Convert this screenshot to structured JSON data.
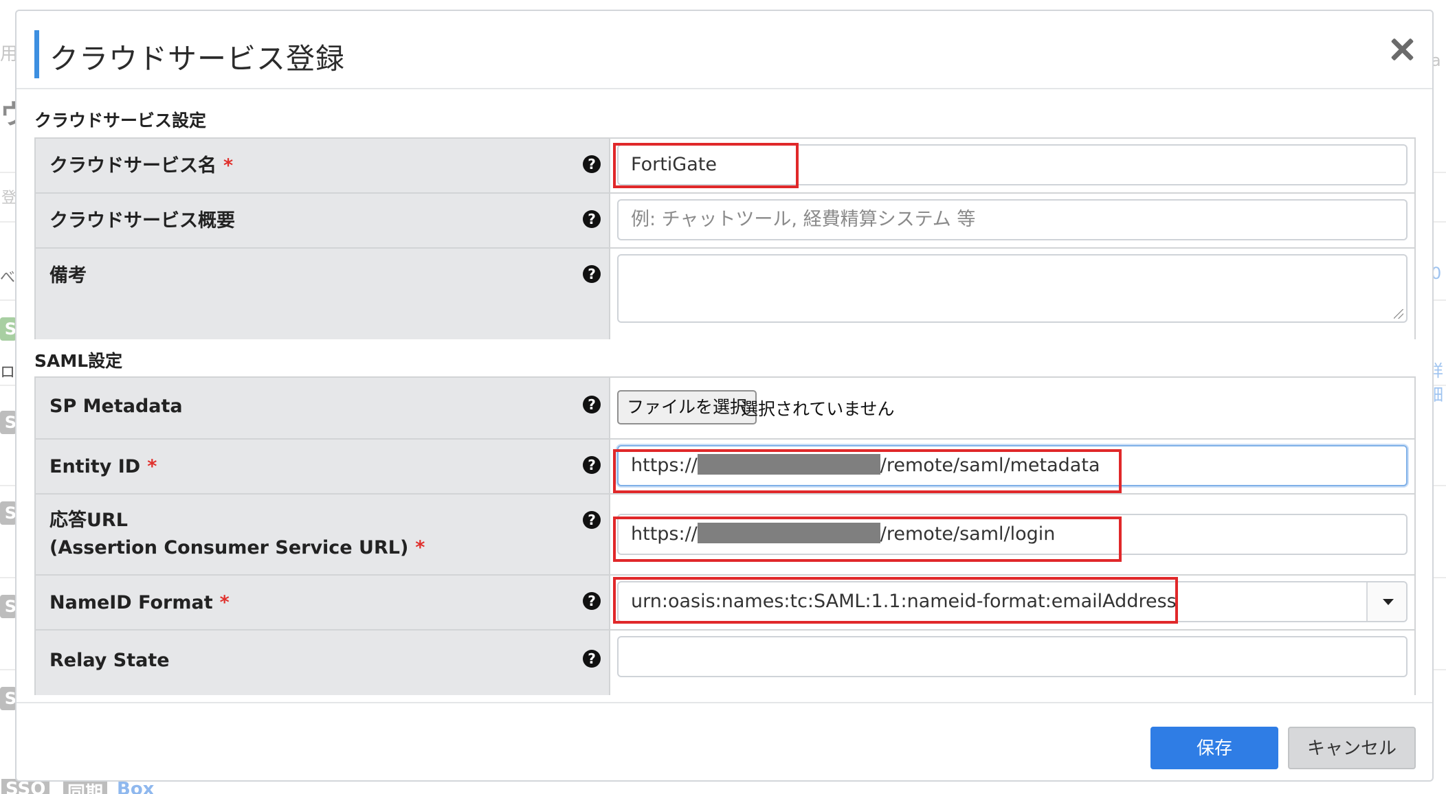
{
  "background": {
    "fragments": [
      "用号",
      "ウ",
      "登",
      "べて",
      "ロ",
      "a",
      "詳細",
      "0"
    ],
    "badges": [
      "S",
      "S",
      "S",
      "S",
      "S"
    ],
    "bottom_labels": [
      "SSO",
      "同期",
      "Box"
    ]
  },
  "modal": {
    "title": "クラウドサービス登録",
    "close_icon": "close-icon"
  },
  "sections": {
    "cloud": {
      "title": "クラウドサービス設定",
      "rows": {
        "name": {
          "label": "クラウドサービス名",
          "required": "*",
          "value": "FortiGate"
        },
        "summary": {
          "label": "クラウドサービス概要",
          "placeholder": "例: チャットツール, 経費精算システム 等"
        },
        "notes": {
          "label": "備考"
        }
      }
    },
    "saml": {
      "title": "SAML設定",
      "rows": {
        "sp_metadata": {
          "label": "SP Metadata",
          "file_button": "ファイルを選択",
          "file_status": "選択されていません"
        },
        "entity_id": {
          "label": "Entity ID",
          "required": "*",
          "value_prefix": "https://",
          "value_suffix": "/remote/saml/metadata"
        },
        "acs_url": {
          "label_line1": "応答URL",
          "label_line2": "(Assertion Consumer Service URL)",
          "required": "*",
          "value_prefix": "https://",
          "value_suffix": "/remote/saml/login"
        },
        "nameid_format": {
          "label": "NameID Format",
          "required": "*",
          "value": "urn:oasis:names:tc:SAML:1.1:nameid-format:emailAddress"
        },
        "relay_state": {
          "label": "Relay State",
          "value": ""
        }
      }
    }
  },
  "help_icon_glyph": "?",
  "footer": {
    "save_label": "保存",
    "cancel_label": "キャンセル"
  },
  "colors": {
    "accent": "#3d8fe0",
    "primary": "#2f7de5",
    "required": "#e0302c",
    "highlight": "#e0282a"
  }
}
